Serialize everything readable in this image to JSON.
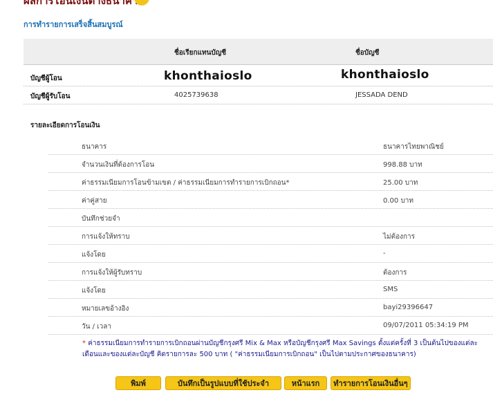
{
  "page": {
    "title": "ผลการโอนเงินต่างธนาคาร",
    "title_icon": "help-icon",
    "status": "การทำรายการเสร็จสิ้นสมบูรณ์"
  },
  "accounts": {
    "headers": {
      "alias": "ชื่อเรียกแทนบัญชี",
      "name": "ชื่อบัญชี"
    },
    "rows": [
      {
        "label": "บัญชีผู้โอน",
        "alias": "",
        "name": ""
      },
      {
        "label": "บัญชีผู้รับโอน",
        "alias": "4025739638",
        "name": "JESSADA DEND"
      }
    ],
    "redaction_alias": "khonthaioslo",
    "redaction_name": "khonthaioslo"
  },
  "details": {
    "title": "รายละเอียดการโอนเงิน",
    "rows": [
      {
        "label": "ธนาคาร",
        "value": "ธนาคารไทยพาณิชย์"
      },
      {
        "label": "จำนวนเงินที่ต้องการโอน",
        "value": "998.88 บาท"
      },
      {
        "label": "ค่าธรรมเนียมการโอนข้ามเขต / ค่าธรรมเนียมการทำรายการเบิกถอน",
        "value": "25.00 บาท",
        "required_mark": "*"
      },
      {
        "label": "ค่าคู่สาย",
        "value": "0.00 บาท"
      },
      {
        "label": "บันทึกช่วยจำ",
        "value": ""
      },
      {
        "label": "การแจ้งให้ทราบ",
        "value": "ไม่ต้องการ"
      },
      {
        "label": "แจ้งโดย",
        "value": "-"
      },
      {
        "label": "การแจ้งให้ผู้รับทราบ",
        "value": "ต้องการ"
      },
      {
        "label": "แจ้งโดย",
        "value": "SMS"
      },
      {
        "label": "หมายเลขอ้างอิง",
        "value": "bayi29396647"
      },
      {
        "label": "วัน / เวลา",
        "value": "09/07/2011 05:34:19 PM"
      }
    ]
  },
  "note": {
    "mark": "*",
    "text": "ค่าธรรมเนียมการทำรายการเบิกถอนผ่านบัญชีกรุงศรี Mix & Max หรือบัญชีกรุงศรี Max Savings ตั้งแต่ครั้งที่ 3 เป็นต้นไปของแต่ละเดือนและของแต่ละบัญชี คิดรายการละ 500 บาท ( \"ค่าธรรมเนียมการเบิกถอน\" เป็นไปตามประกาศของธนาคาร)"
  },
  "buttons": {
    "print": "พิมพ์",
    "save_template": "บันทึกเป็นรูปแบบที่ใช้ประจำ",
    "home": "หน้าแรก",
    "other_transfer": "ทำรายการโอนเงินอื่นๆ"
  },
  "colors": {
    "accent": "#f5c518",
    "title": "#7a1010",
    "link": "#1a6fb5",
    "note": "#1a1a8c"
  }
}
